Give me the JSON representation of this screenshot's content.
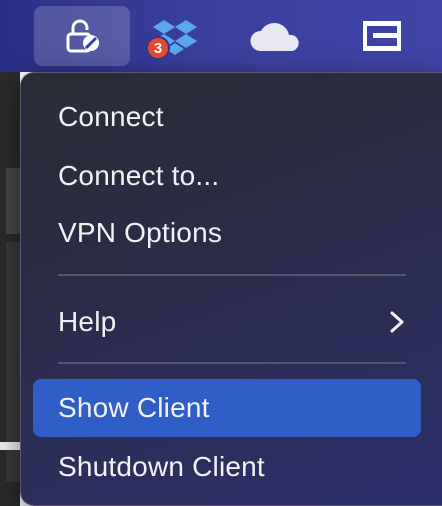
{
  "menubar": {
    "dropbox_badge_count": "3"
  },
  "menu": {
    "items": [
      {
        "label": "Connect"
      },
      {
        "label": "Connect to..."
      },
      {
        "label": "VPN Options"
      },
      {
        "label": "Help"
      },
      {
        "label": "Show Client"
      },
      {
        "label": "Shutdown Client"
      }
    ]
  },
  "icons": {
    "vpn_lock": "lock-slash-icon",
    "dropbox": "dropbox-icon",
    "cloud": "onedrive-cloud-icon",
    "screen": "screen-mirror-icon",
    "submenu": "chevron-right-icon"
  },
  "colors": {
    "menubar": "#3a3f9c",
    "menu_background": "#2b2c47",
    "highlight": "#2f5ec6",
    "badge": "#e64a2e",
    "dropbox_blue": "#5aa7f0"
  }
}
